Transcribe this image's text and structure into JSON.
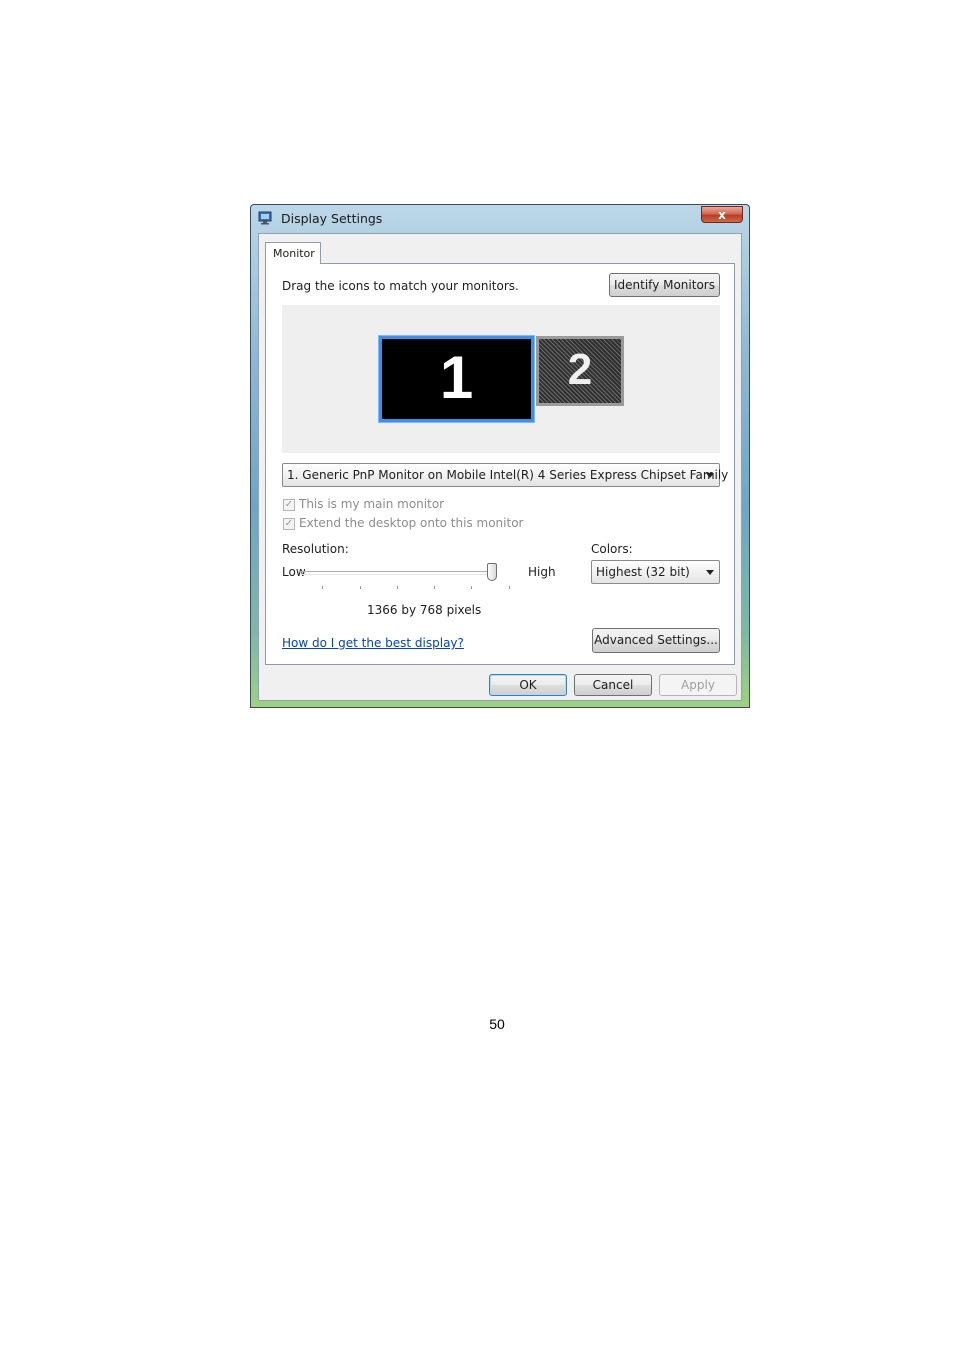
{
  "window": {
    "title": "Display Settings",
    "close_glyph": "x"
  },
  "tabs": [
    {
      "label": "Monitor"
    }
  ],
  "monitor_tab": {
    "instruction": "Drag the icons to match your monitors.",
    "identify_button": "Identify Monitors",
    "monitors": [
      {
        "number": "1",
        "selected": true
      },
      {
        "number": "2",
        "selected": false
      }
    ],
    "monitor_select": {
      "value": "1. Generic PnP Monitor on Mobile Intel(R) 4 Series Express Chipset Family"
    },
    "checkboxes": [
      {
        "label": "This is my main monitor",
        "checked": true,
        "disabled": true
      },
      {
        "label": "Extend the desktop onto this monitor",
        "checked": true,
        "disabled": true
      }
    ],
    "resolution": {
      "label": "Resolution:",
      "low_label": "Low",
      "high_label": "High",
      "value_text": "1366 by 768 pixels",
      "slider_fraction": 1.0
    },
    "colors": {
      "label": "Colors:",
      "value": "Highest (32 bit)"
    },
    "help_link": "How do I get the best display?",
    "advanced_button": "Advanced Settings..."
  },
  "footer": {
    "ok": "OK",
    "cancel": "Cancel",
    "apply": "Apply"
  },
  "page_number": "50",
  "colors_used": {
    "selection_border": "#3f8fe8",
    "link": "#0645ad",
    "close_button": "#c8462f"
  }
}
